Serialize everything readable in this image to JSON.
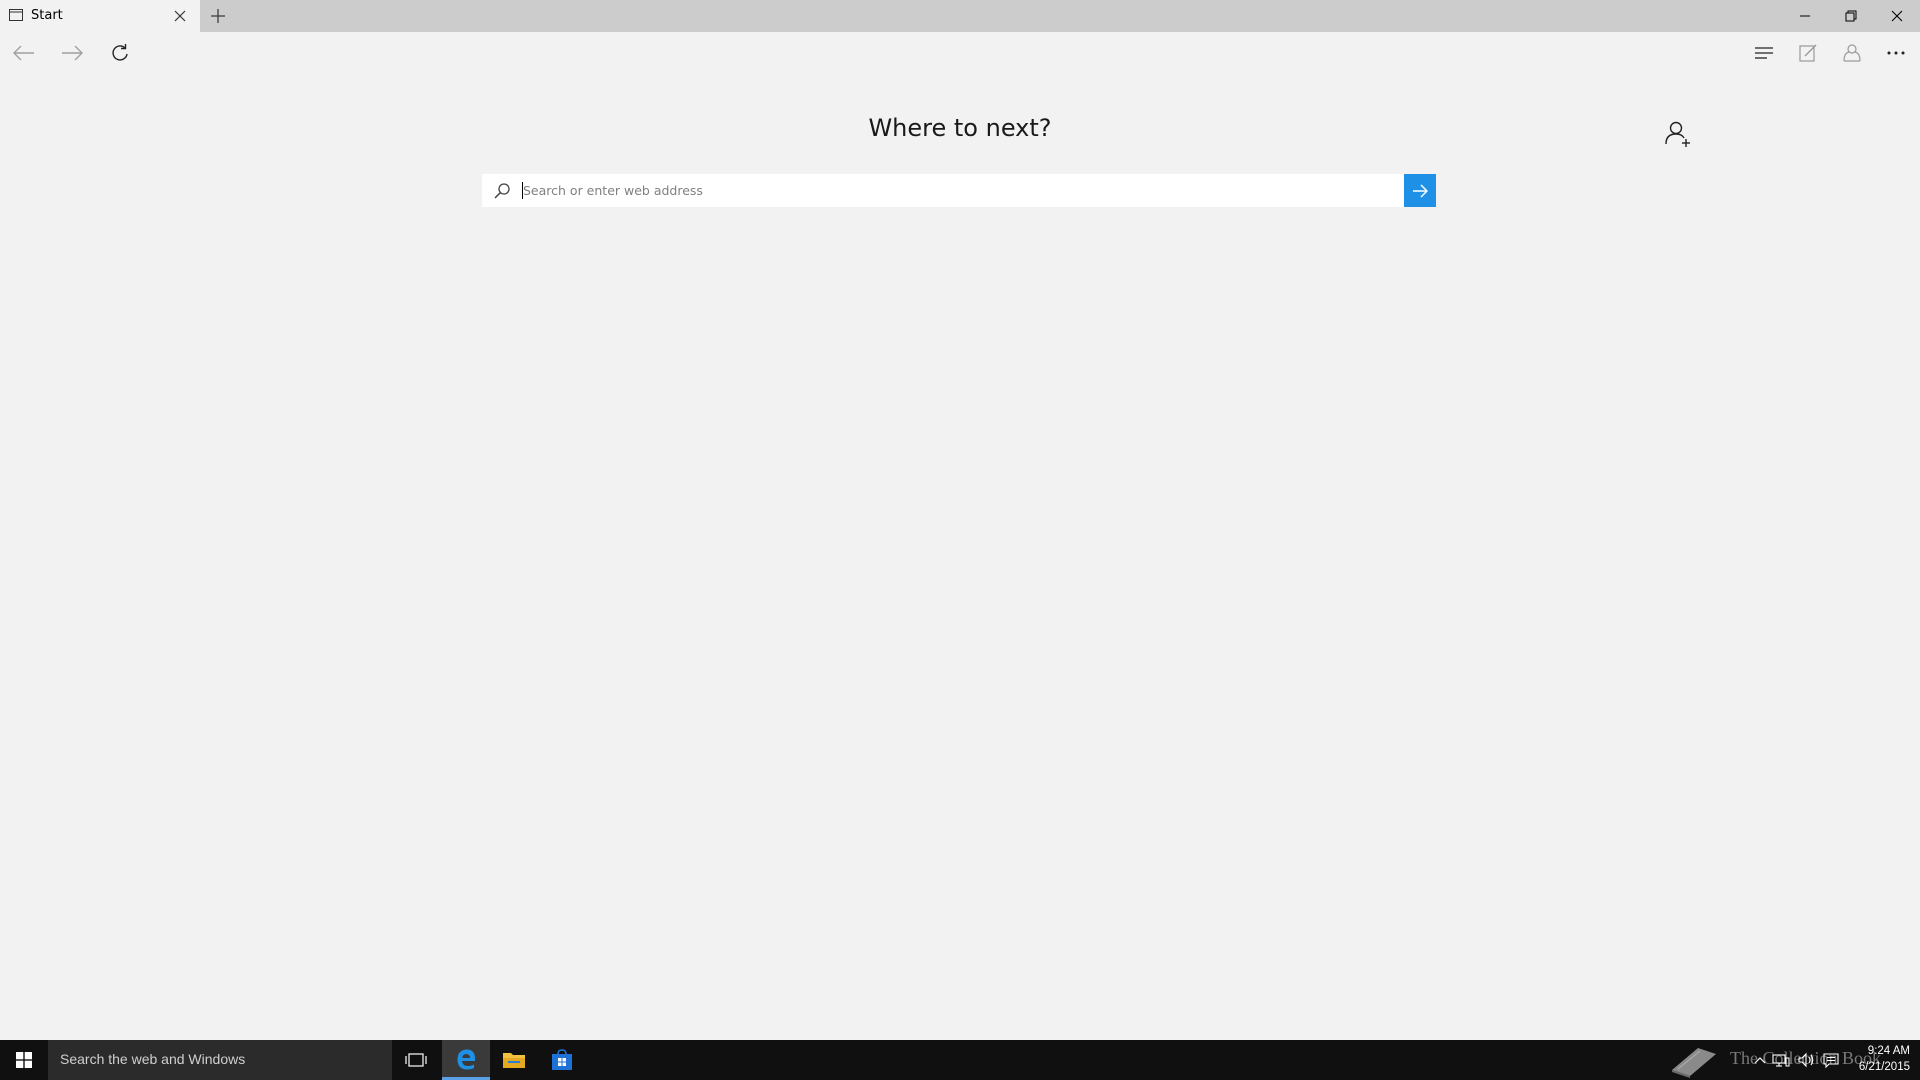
{
  "tab": {
    "title": "Start"
  },
  "page": {
    "heading": "Where to next?"
  },
  "search": {
    "placeholder": "Search or enter web address",
    "value": ""
  },
  "taskbar": {
    "search_placeholder": "Search the web and Windows",
    "watermark": "The Collection Book",
    "time": "9:24 AM",
    "date": "6/21/2015"
  },
  "colors": {
    "accent": "#1e90e6",
    "taskbar": "#101010",
    "tabbar": "#cccccc",
    "page": "#f2f2f2"
  },
  "icons": [
    "tab-page-icon",
    "close-icon",
    "plus-icon",
    "minimize-icon",
    "restore-icon",
    "window-close-icon",
    "back-arrow-icon",
    "forward-arrow-icon",
    "refresh-icon",
    "hub-icon",
    "web-note-icon",
    "share-icon",
    "more-icon",
    "add-person-icon",
    "search-icon",
    "arrow-right-icon",
    "windows-logo-icon",
    "task-view-icon",
    "edge-icon",
    "file-explorer-icon",
    "store-icon",
    "book-icon",
    "chevron-up-icon",
    "network-icon",
    "volume-icon",
    "action-center-icon"
  ]
}
